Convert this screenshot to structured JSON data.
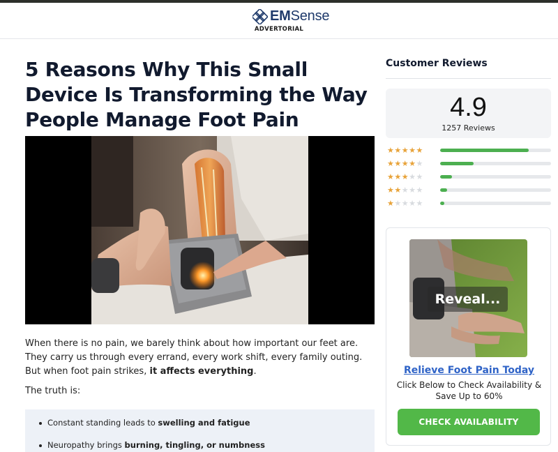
{
  "header": {
    "brand_prefix": "EM",
    "brand_suffix": "Sense",
    "subtitle": "ADVERTORIAL",
    "logo_icon": "diamond-knot-icon",
    "brand_color": "#1f3a6b"
  },
  "article": {
    "headline": "5 Reasons Why This Small Device Is Transforming the Way People Manage Foot Pain",
    "hero_image": "woman-using-knee-massager-image",
    "intro_text": "When there is no pain, we barely think about how important our feet are. They carry us through every errand, every work shift, every family outing. But when foot pain strikes,",
    "intro_bold": "it affects everything",
    "intro_end": ".",
    "truth_label": "The truth is:",
    "bullets": [
      {
        "text": "Constant standing leads to ",
        "bold": "swelling and fatigue"
      },
      {
        "text": "Neuropathy brings ",
        "bold": "burning, tingling, or numbness"
      }
    ]
  },
  "reviews": {
    "title": "Customer Reviews",
    "score": "4.9",
    "count": "1257 Reviews",
    "star_color": "#e8a33a",
    "bar_color": "#4caf50",
    "breakdown": [
      {
        "stars": 5,
        "fraction": 0.8
      },
      {
        "stars": 4,
        "fraction": 0.3
      },
      {
        "stars": 3,
        "fraction": 0.11
      },
      {
        "stars": 2,
        "fraction": 0.06
      },
      {
        "stars": 1,
        "fraction": 0.04
      }
    ]
  },
  "promo": {
    "image": "feet-on-grass-image",
    "reveal_label": "Reveal...",
    "link_text": "Relieve Foot Pain Today",
    "body_text": "Click Below to Check Availability & Save Up to 60%",
    "cta_label": "CHECK AVAILABILITY",
    "cta_color": "#52b848"
  }
}
